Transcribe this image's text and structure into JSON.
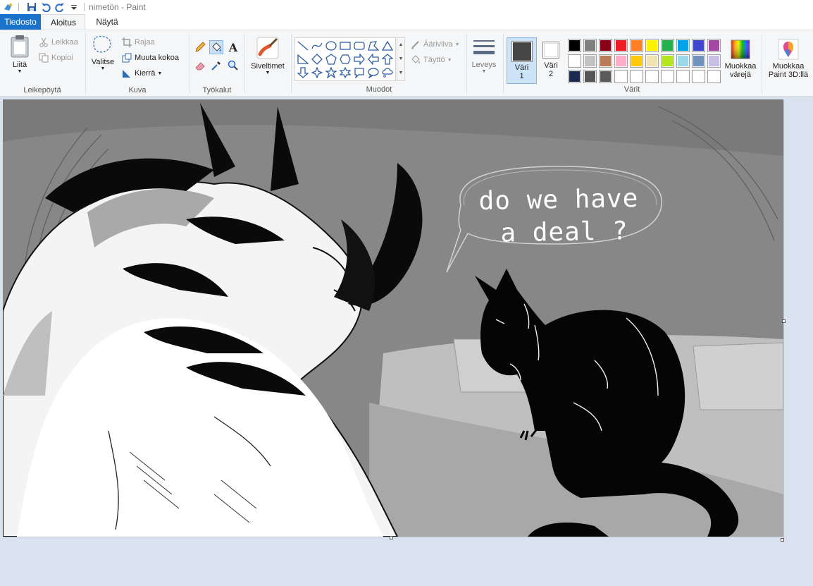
{
  "window": {
    "title": "nimetön - Paint"
  },
  "tabs": {
    "file": "Tiedosto",
    "home": "Aloitus",
    "view": "Näytä"
  },
  "clipboard": {
    "paste": "Liitä",
    "cut": "Leikkaa",
    "copy": "Kopioi",
    "label": "Leikepöytä"
  },
  "image": {
    "select": "Valitse",
    "crop": "Rajaa",
    "resize": "Muuta kokoa",
    "rotate": "Kierrä",
    "label": "Kuva"
  },
  "tools": {
    "label": "Työkalut",
    "items": [
      "pencil-icon",
      "fill-bucket-icon",
      "text-icon",
      "eraser-icon",
      "color-picker-icon",
      "magnifier-icon"
    ],
    "active": "fill-bucket-icon"
  },
  "brushes": {
    "label": "Siveltimet"
  },
  "shapes": {
    "outline": "Ääriviiva",
    "fill": "Täyttö",
    "label": "Muodot"
  },
  "size": {
    "label": "Leveys"
  },
  "colors": {
    "color1_label": "Väri",
    "color1_num": "1",
    "color1_value": "#464646",
    "color2_label": "Väri",
    "color2_num": "2",
    "color2_value": "#ffffff",
    "label": "Värit",
    "palette": [
      "#000000",
      "#7f7f7f",
      "#880015",
      "#ed1c24",
      "#ff7f27",
      "#fff200",
      "#22b14c",
      "#00a2e8",
      "#3f48cc",
      "#a349a4",
      "#ffffff",
      "#c3c3c3",
      "#b97a57",
      "#ffaec9",
      "#ffc90e",
      "#efe4b0",
      "#b5e61d",
      "#99d9ea",
      "#7092be",
      "#c8bfe7",
      "#1b2a4f",
      "#555555",
      "#5a5a5a",
      "#ffffff",
      "#ffffff",
      "#ffffff",
      "#ffffff",
      "#ffffff",
      "#ffffff",
      "#ffffff"
    ],
    "edit_colors": [
      "Muokkaa",
      "värejä"
    ],
    "paint3d": [
      "Muokkaa",
      "Paint 3D:llä"
    ]
  },
  "canvas": {
    "speech_line1": "do we have",
    "speech_line2": "a deal ?"
  }
}
